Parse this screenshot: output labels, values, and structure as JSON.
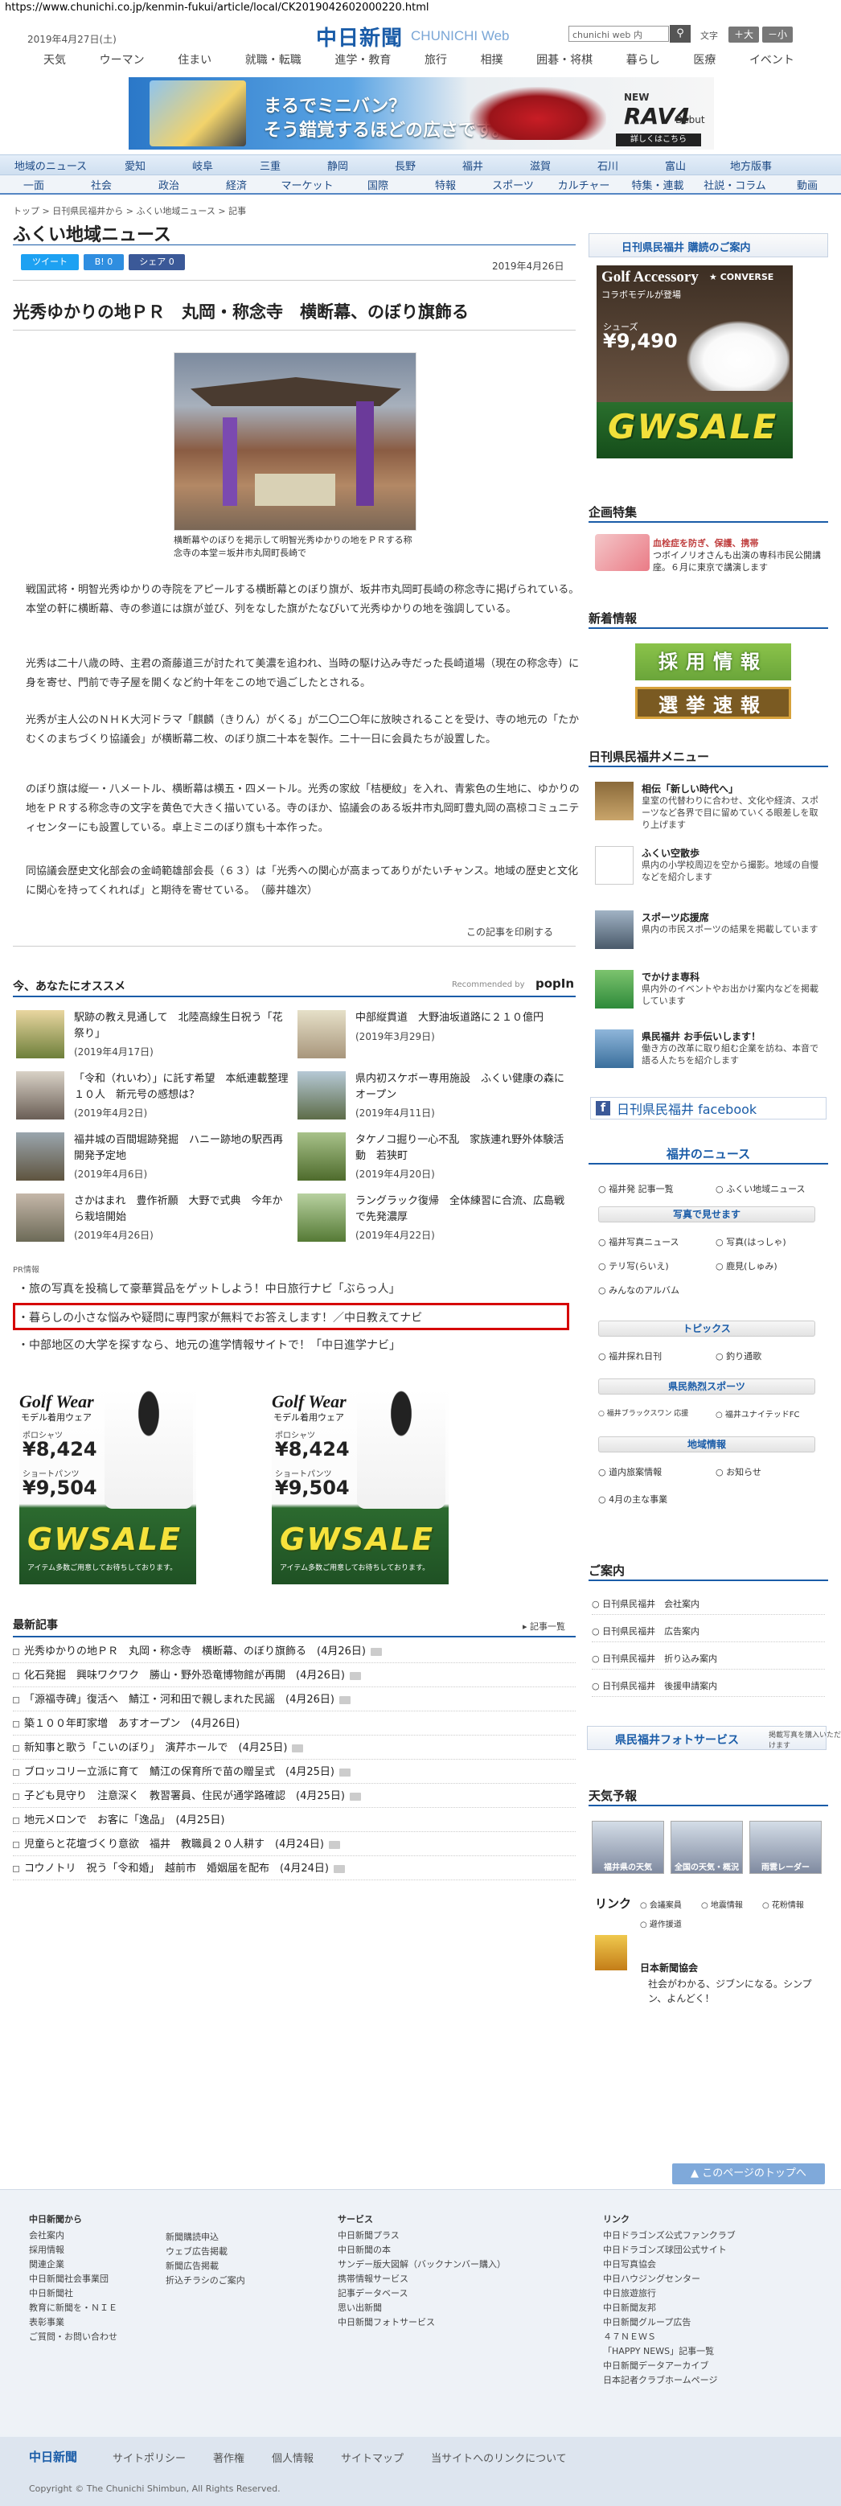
{
  "url": "https://www.chunichi.co.jp/kenmin-fukui/article/local/CK2019042602000220.html",
  "header": {
    "date": "2019年4月27日(土)",
    "logo_ja": "中日新聞",
    "logo_en": "CHUNICHI Web",
    "search_placeholder": "chunichi web 内",
    "font_label": "文字",
    "font_large": "＋大",
    "font_small": "－小"
  },
  "global_nav": [
    "天気",
    "ウーマン",
    "住まい",
    "就職・転職",
    "進学・教育",
    "旅行",
    "相撲",
    "囲碁・将棋",
    "暮らし",
    "医療",
    "イベント"
  ],
  "banner": {
    "copy1": "まるでミニバン？",
    "copy2": "そう錯覚するほどの広さです。",
    "newr": "NEW",
    "model": "RAV4",
    "debut": "Debut",
    "more": "詳しくはこちら"
  },
  "region_nav1": [
    "地域のニュース",
    "愛知",
    "岐阜",
    "三重",
    "静岡",
    "長野",
    "福井",
    "滋賀",
    "石川",
    "富山",
    "地方版事"
  ],
  "region_nav2": [
    "一面",
    "社会",
    "政治",
    "経済",
    "マーケット",
    "国際",
    "特報",
    "スポーツ",
    "カルチャー",
    "特集・連載",
    "社説・コラム",
    "動画"
  ],
  "breadcrumb": "トップ > 日刊県民福井から > ふくい地域ニュース > 記事",
  "page_title": "ふくい地域ニュース",
  "share": {
    "tweet": "ツイート",
    "b": "B! 0",
    "fb": "シェア 0"
  },
  "article": {
    "date": "2019年4月26日",
    "headline": "光秀ゆかりの地ＰＲ　丸岡・称念寺　横断幕、のぼり旗飾る",
    "caption": "横断幕やのぼりを掲示して明智光秀ゆかりの地をＰＲする称念寺の本堂＝坂井市丸岡町長崎で",
    "paras": [
      "戦国武将・明智光秀ゆかりの寺院をアピールする横断幕とのぼり旗が、坂井市丸岡町長崎の称念寺に掲げられている。本堂の軒に横断幕、寺の参道には旗が並び、列をなした旗がたなびいて光秀ゆかりの地を強調している。",
      "光秀は二十八歳の時、主君の斎藤道三が討たれて美濃を追われ、当時の駆け込み寺だった長崎道場（現在の称念寺）に身を寄せ、門前で寺子屋を開くなど約十年をこの地で過ごしたとされる。",
      "光秀が主人公のＮＨＫ大河ドラマ「麒麟（きりん）がくる」が二〇二〇年に放映されることを受け、寺の地元の「たかむくのまちづくり協議会」が横断幕二枚、のぼり旗二十本を製作。二十一日に会員たちが設置した。",
      "のぼり旗は縦一・八メートル、横断幕は横五・四メートル。光秀の家紋「桔梗紋」を入れ、青紫色の生地に、ゆかりの地をＰＲする称念寺の文字を黄色で大きく描いている。寺のほか、協議会のある坂井市丸岡町豊丸岡の高椋コミュニティセンターにも設置している。卓上ミニのぼり旗も十本作った。",
      "同協議会歴史文化部会の金崎範雄部会長（６３）は「光秀への関心が高まってありがたいチャンス。地域の歴史と文化に関心を持ってくれれば」と期待を寄せている。　（藤井雄次）"
    ],
    "print": "この記事を印刷する"
  },
  "recommend": {
    "title": "今、あなたにオススメ",
    "powered": "Recommended by",
    "popin": "popIn",
    "items": [
      {
        "title": "駅跡の教え見通して　北陸高線生日祝う「花祭り」",
        "date": "(2019年4月17日)"
      },
      {
        "title": "中部縦貫道　大野油坂道路に２１０億円",
        "date": "(2019年3月29日)"
      },
      {
        "title": "「令和（れいわ）」に託す希望　本紙連載整理１０人　新元号の感想は？",
        "date": "(2019年4月2日)"
      },
      {
        "title": "県内初スケボー専用施設　ふくい健康の森にオープン",
        "date": "(2019年4月11日)"
      },
      {
        "title": "福井城の百間堀跡発掘　ハニー跡地の駅西再開発予定地",
        "date": "(2019年4月6日)"
      },
      {
        "title": "タケノコ掘り一心不乱　家族連れ野外体験活動　若狭町",
        "date": "(2019年4月20日)"
      },
      {
        "title": "さかはまれ　豊作祈願　大野で式典　今年から栽培開始",
        "date": "(2019年4月26日)"
      },
      {
        "title": "ラングラック復帰　全体練習に合流、広島戦で先発濃厚",
        "date": "(2019年4月22日)"
      }
    ]
  },
  "pr": {
    "label": "PR情報",
    "items": [
      "旅の写真を投稿して豪華賞品をゲットしよう！中日旅行ナビ「ぶらっ人」",
      "暮らしの小さな悩みや疑問に専門家が無料でお答えします！／中日教えてナビ",
      "中部地区の大学を探すなら、地元の進学情報サイトで！「中日進学ナビ」"
    ]
  },
  "ads": {
    "golf_wear": "Golf Wear",
    "golf_sub": "モデル着用ウェア",
    "polo": "ポロシャツ",
    "polo_price": "¥8,424",
    "shorts": "ショートパンツ",
    "shorts_price": "¥9,504",
    "sale": "GWSALE",
    "sale_sub": "アイテム多数ご用意してお待ちしております。",
    "golf_acc": "Golf Accessory",
    "golf_acc_sub": "コラボモデルが登場",
    "converse": "CONVERSE",
    "shoe_label": "シューズ",
    "shoe_price": "¥9,490"
  },
  "latest": {
    "title": "最新記事",
    "all": "記事一覧",
    "items": [
      "光秀ゆかりの地ＰＲ　丸岡・称念寺　横断幕、のぼり旗飾る　(4月26日)",
      "化石発掘　興味ワクワク　勝山・野外恐竜博物館が再開　(4月26日)",
      "「源福寺碑」復活へ　鯖江・河和田で親しまれた民謡　(4月26日)",
      "築１００年町家増　あすオープン　(4月26日)",
      "新知事と歌う「こいのぼり」　演芹ホールで　(4月25日)",
      "ブロッコリー立派に育て　鯖江の保育所で苗の贈呈式　(4月25日)",
      "子ども見守り　注意深く　教習署員、住民が通学路確認　(4月25日)",
      "地元メロンで　お客に「逸品」　(4月25日)",
      "児童らと花壇づくり意欲　福井　教職員２０人耕す　(4月24日)",
      "コウノトリ　祝う「令和婚」　越前市　婚姻届を配布　(4月24日)"
    ]
  },
  "sidebar": {
    "subscribe": "日刊県民福井 購読のご案内",
    "kikaku": "企画特集",
    "kikaku_item_title": "血栓症を防ぎ、保護、携帯",
    "kikaku_item_desc": "つボイノリオさんも出演の専科市民公開講座。６月に東京で講演します",
    "shinchaku": "新着情報",
    "saiyo": "採用情報",
    "senkyo": "選挙速報",
    "menu_title": "日刊県民福井メニュー",
    "menu_items": [
      {
        "title": "相伝「新しい時代へ」",
        "desc": "皇室の代替わりに合わせ、文化や経済、スポーツなど各界で目に留めていくる眼差しを取り上げます"
      },
      {
        "title": "ふくい空散歩",
        "desc": "県内の小学校周辺を空から撮影。地域の自慢などを紹介します"
      },
      {
        "title": "スポーツ応援席",
        "desc": "県内の市民スポーツの結果を掲載しています"
      },
      {
        "title": "でかけま専科",
        "desc": "県内外のイベントやお出かけ案内などを掲載しています"
      },
      {
        "title": "県民福井 お手伝いします！",
        "desc": "働き方の改革に取り組む企業を訪ね、本音で語る人たちを紹介します"
      }
    ],
    "facebook": "日刊県民福井 facebook",
    "fukui_news": "福井のニュース",
    "fn_links": [
      "福井発 記事一覧",
      "ふくい地域ニュース"
    ],
    "photo_title": "写真で見せます",
    "photo_links": [
      "福井写真ニュース",
      "写真(はっしゃ)",
      "テリ写(らいえ)",
      "鹿見(しゅみ)",
      "みんなのアルバム"
    ],
    "topics": "トピックス",
    "topic_links": [
      "福井探れ日刊",
      "釣り通歌"
    ],
    "sports": "県民熱烈スポーツ",
    "sports_links": [
      "福井ブラックスワン 応援",
      "福井ユナイテッドFC"
    ],
    "chiiki": "地域情報",
    "chiiki_links": [
      "道内旅案情報",
      "お知らせ",
      "4月の主な事業"
    ],
    "goannai": "ご案内",
    "annai_items": [
      "日刊県民福井　会社案内",
      "日刊県民福井　広告案内",
      "日刊県民福井　折り込み案内",
      "日刊県民福井　後援申請案内"
    ],
    "photosvc": "県民福井フォトサービス",
    "photosvc2": "掲載写真を購入いただけます",
    "tenki": "天気予報",
    "weather": [
      "福井県の天気",
      "全国の天気・概況",
      "雨雲レーダー"
    ],
    "link": "リンク",
    "link_items": [
      "会議案員",
      "地震情報",
      "花粉情報",
      "避作援道"
    ],
    "ad2_title": "日本新聞協会",
    "ad2_desc": "社会がわかる、ジブンになる。シンプン、よんどく！"
  },
  "to_top": "このページのトップへ",
  "footer": {
    "col1_title": "中日新聞から",
    "col1": [
      "会社案内",
      "採用情報",
      "関連企業",
      "中日新聞社会事業団",
      "中日新聞社",
      "教育に新聞を・ＮＩＥ",
      "表彰事業",
      "ご質問・お問い合わせ"
    ],
    "col2": [
      "新聞購読申込",
      "ウェブ広告掲載",
      "新聞広告掲載",
      "折込チラシのご案内"
    ],
    "col3_title": "サービス",
    "col3": [
      "中日新聞プラス",
      "中日新聞の本",
      "サンデー版大図解（バックナンバー購入）",
      "携帯情報サービス",
      "記事データベース",
      "思い出新聞",
      "中日新聞フォトサービス"
    ],
    "col4_title": "リンク",
    "col4": [
      "中日ドラゴンズ公式ファンクラブ",
      "中日ドラゴンズ球団公式サイト",
      "中日写真協会",
      "中日ハウジングセンター",
      "中日旅遊旅行",
      "中日新聞友邦",
      "中日新聞グループ広告",
      "４７ＮＥＷＳ",
      "「HAPPY NEWS」記事一覧",
      "中日新聞データアーカイブ",
      "日本記者クラブホームページ"
    ],
    "logo": "中日新聞",
    "links": [
      "サイトポリシー",
      "著作権",
      "個人情報",
      "サイトマップ",
      "当サイトへのリンクについて"
    ],
    "copyright": "Copyright © The Chunichi Shimbun, All Rights Reserved."
  }
}
